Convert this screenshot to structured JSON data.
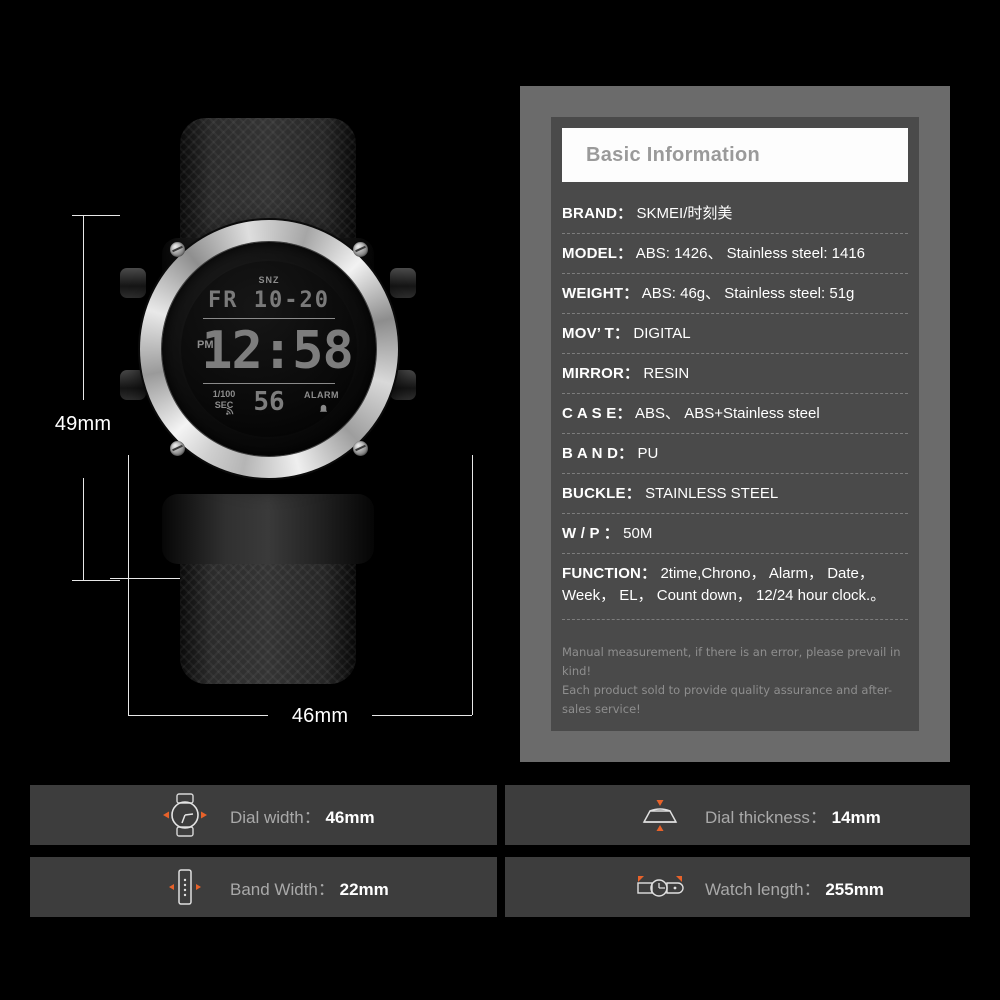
{
  "dimensions": {
    "height_label": "49mm",
    "width_label": "46mm"
  },
  "watch_display": {
    "snz": "SNZ",
    "date": "FR 10-20",
    "ampm": "PM",
    "time": "12:58",
    "sec_label_top": "1/100",
    "sec_label_bottom": "SEC",
    "seconds": "56",
    "alarm": "ALARM",
    "bell_icon": "♪",
    "signal_icon": "◠"
  },
  "spec_panel": {
    "header": "Basic Information",
    "rows": [
      {
        "key": "BRAND：",
        "value": "SKMEI/时刻美"
      },
      {
        "key": "MODEL：",
        "value": "ABS: 1426、 Stainless steel: 1416"
      },
      {
        "key": "WEIGHT：",
        "value": "ABS: 46g、 Stainless steel: 51g"
      },
      {
        "key": "MOV’ T：",
        "value": "DIGITAL"
      },
      {
        "key": "MIRROR：",
        "value": "RESIN"
      },
      {
        "key": "C A S E：",
        "value": "ABS、 ABS+Stainless steel"
      },
      {
        "key": "B A N D：",
        "value": "PU"
      },
      {
        "key": "BUCKLE：",
        "value": "STAINLESS STEEL"
      },
      {
        "key": "W / P ：",
        "value": "50M"
      },
      {
        "key": "FUNCTION：",
        "value": "2time,Chrono， Alarm， Date， Week， EL， Count down， 12/24 hour clock.。"
      }
    ],
    "note_line1": "Manual measurement, if there is an error, please prevail in kind!",
    "note_line2": "Each product sold to provide quality assurance and after-sales service!"
  },
  "feature_cards": [
    {
      "icon": "watch-dial-width-icon",
      "label": "Dial width：",
      "value": "46mm"
    },
    {
      "icon": "watch-dial-thickness-icon",
      "label": "Dial thickness：",
      "value": "14mm"
    },
    {
      "icon": "watch-band-width-icon",
      "label": "Band Width：",
      "value": "22mm"
    },
    {
      "icon": "watch-length-icon",
      "label": "Watch length：",
      "value": "255mm"
    }
  ],
  "colors": {
    "background": "#000000",
    "panel_outer": "#6b6b6b",
    "panel_inner": "#4a4a4a",
    "header_bg": "#fdfdfd",
    "card_bg": "#3d3d3d",
    "accent_orange": "#e8622a"
  }
}
